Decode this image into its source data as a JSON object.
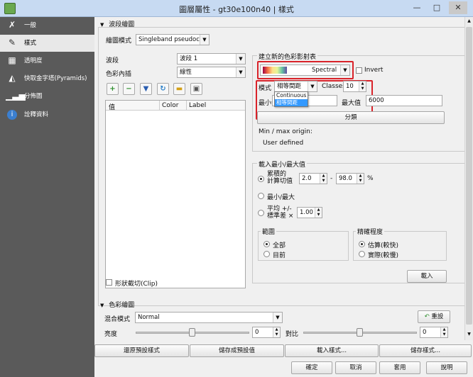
{
  "window": {
    "title": "圖層屬性 - gt30e100n40 | 樣式",
    "controls": [
      "—",
      "□",
      "✕"
    ]
  },
  "sidebar": {
    "items": [
      {
        "label": "一般",
        "icon": "wrench-icon"
      },
      {
        "label": "樣式",
        "icon": "paintbrush-icon",
        "selected": true
      },
      {
        "label": "透明度",
        "icon": "transparency-icon"
      },
      {
        "label": "快取金字塔(Pyramids)",
        "icon": "pyramid-icon"
      },
      {
        "label": "分佈圖",
        "icon": "histogram-icon"
      },
      {
        "label": "詮釋資料",
        "icon": "info-icon"
      }
    ]
  },
  "band_render": {
    "section_title": "波段繪圖",
    "render_type_label": "繪圖模式",
    "render_type_value": "Singleband pseudocolor",
    "band_label": "波段",
    "band_value": "波段 1",
    "interp_label": "色彩內插",
    "interp_value": "線性",
    "table_headers": [
      "值",
      "Color",
      "Label"
    ],
    "clip_label": "形狀截切(Clip)"
  },
  "new_ramp": {
    "title": "建立新的色彩影射表",
    "ramp_value": "Spectral",
    "invert_label": "Invert",
    "mode_label": "模式",
    "mode_value": "相等間距",
    "mode_options": [
      "Continuous",
      "相等間距"
    ],
    "classes_label": "Classes",
    "classes_value": "10",
    "min_label": "最小值",
    "max_label": "最大值",
    "max_value": "6000",
    "classify_button": "分類",
    "origin_label": "Min / max origin:",
    "origin_value": "User defined"
  },
  "load_minmax": {
    "title": "載入最小/最大值",
    "cumulative_label_1": "累積的",
    "cumulative_label_2": "計算切值",
    "cum_low": "2.0",
    "cum_dash": "-",
    "cum_high": "98.0",
    "cum_unit": "%",
    "minmax_label": "最小/最大",
    "mean_label_1": "平均 +/-",
    "mean_label_2": "標準差 ×",
    "mean_value": "1.00",
    "extent_title": "範圍",
    "extent_options": [
      "全部",
      "目前"
    ],
    "accuracy_title": "精確程度",
    "accuracy_options": [
      "估算(較快)",
      "實際(較慢)"
    ],
    "load_button": "載入"
  },
  "color_render": {
    "section_title": "色彩繪圖",
    "blend_label": "混合模式",
    "blend_value": "Normal",
    "reset_button": "重設",
    "brightness_label": "亮度",
    "brightness_value": "0",
    "contrast_label": "對比",
    "contrast_value": "0"
  },
  "style_buttons": [
    "還原預設樣式",
    "儲存成預設值",
    "載入樣式...",
    "儲存樣式..."
  ],
  "dialog_buttons": [
    "確定",
    "取消",
    "套用",
    "說明"
  ]
}
